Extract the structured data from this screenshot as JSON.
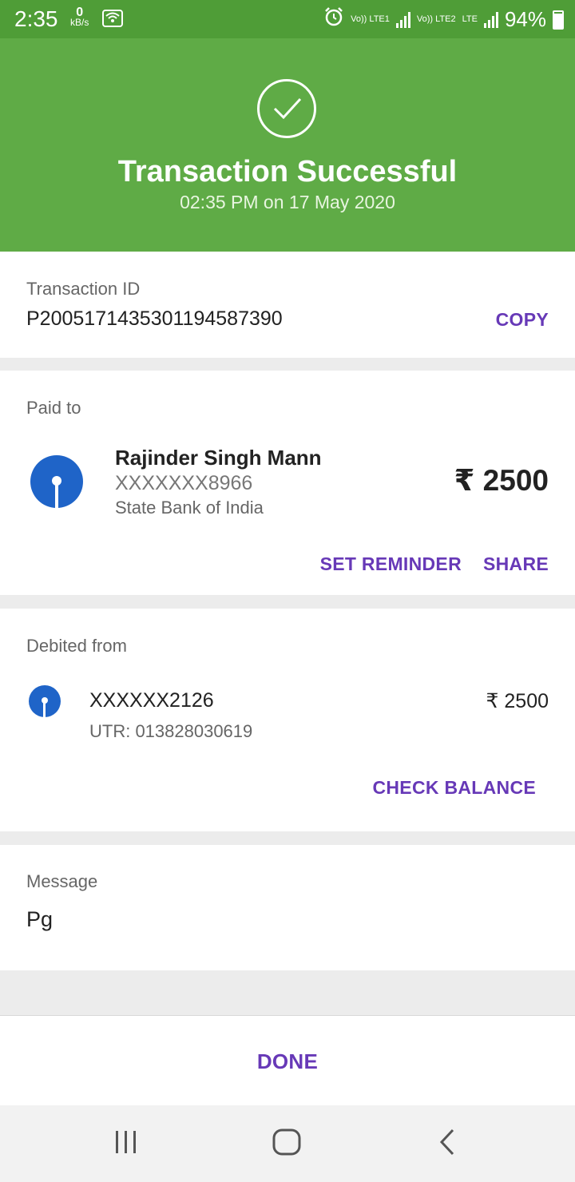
{
  "status_bar": {
    "time": "2:35",
    "speed_value": "0",
    "speed_unit": "kB/s",
    "sim1": "Vo)) LTE1",
    "sim2": "Vo)) LTE2",
    "sim2_tech": "LTE",
    "battery": "94%"
  },
  "header": {
    "title": "Transaction Successful",
    "datetime": "02:35 PM on 17 May 2020",
    "color": "#5fab46"
  },
  "transaction": {
    "label": "Transaction ID",
    "id": "P2005171435301194587390",
    "copy_label": "COPY"
  },
  "paid_to": {
    "label": "Paid to",
    "name": "Rajinder Singh Mann",
    "account": "XXXXXXX8966",
    "bank": "State Bank of India",
    "amount": "₹ 2500",
    "bank_icon": "sbi-logo-icon",
    "set_reminder_label": "SET REMINDER",
    "share_label": "SHARE"
  },
  "debited_from": {
    "label": "Debited from",
    "account": "XXXXXX2126",
    "utr": "UTR: 013828030619",
    "amount": "₹ 2500",
    "check_balance_label": "CHECK BALANCE"
  },
  "message": {
    "label": "Message",
    "text": "Pg"
  },
  "done_label": "DONE",
  "accent_color": "#6739b7"
}
